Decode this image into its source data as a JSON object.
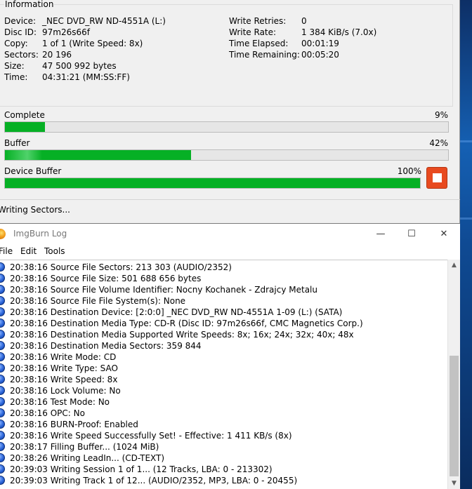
{
  "info": {
    "legend": "Information",
    "left": [
      {
        "label": "Device:",
        "value": "_NEC DVD_RW ND-4551A (L:)"
      },
      {
        "label": "Disc ID:",
        "value": "97m26s66f"
      },
      {
        "label": "Copy:",
        "value": "1 of 1 (Write Speed: 8x)"
      },
      {
        "label": "Sectors:",
        "value": "20 196"
      },
      {
        "label": "Size:",
        "value": "47 500 992 bytes"
      },
      {
        "label": "Time:",
        "value": "04:31:21 (MM:SS:FF)"
      }
    ],
    "right": [
      {
        "label": "Write Retries:",
        "value": "0"
      },
      {
        "label": "Write Rate:",
        "value": "1 384 KiB/s (7.0x)"
      },
      {
        "label": "Time Elapsed:",
        "value": "00:01:19"
      },
      {
        "label": "Time Remaining:",
        "value": "00:05:20"
      }
    ]
  },
  "progress": {
    "complete": {
      "label": "Complete",
      "pct_text": "9%",
      "fraction": 0.09
    },
    "buffer": {
      "label": "Buffer",
      "pct_text": "42%",
      "fraction": 0.42
    },
    "device_buffer": {
      "label": "Device Buffer",
      "pct_text": "100%",
      "fraction": 1.0
    }
  },
  "status": {
    "text": "Writing Sectors..."
  },
  "log": {
    "title": "ImgBurn Log",
    "controls": {
      "minimize": "—",
      "maximize": "☐",
      "close": "✕"
    },
    "menu": [
      "File",
      "Edit",
      "Tools"
    ],
    "lines": [
      "20:38:16 Source File Sectors: 213 303 (AUDIO/2352)",
      "20:38:16 Source File Size: 501 688 656 bytes",
      "20:38:16 Source File Volume Identifier: Nocny Kochanek - Zdrajcy Metalu",
      "20:38:16 Source File File System(s): None",
      "20:38:16 Destination Device: [2:0:0] _NEC DVD_RW ND-4551A 1-09 (L:) (SATA)",
      "20:38:16 Destination Media Type: CD-R (Disc ID: 97m26s66f, CMC Magnetics Corp.)",
      "20:38:16 Destination Media Supported Write Speeds: 8x; 16x; 24x; 32x; 40x; 48x",
      "20:38:16 Destination Media Sectors: 359 844",
      "20:38:16 Write Mode: CD",
      "20:38:16 Write Type: SAO",
      "20:38:16 Write Speed: 8x",
      "20:38:16 Lock Volume: No",
      "20:38:16 Test Mode: No",
      "20:38:16 OPC: No",
      "20:38:16 BURN-Proof: Enabled",
      "20:38:16 Write Speed Successfully Set! - Effective: 1 411 KB/s (8x)",
      "20:38:17 Filling Buffer... (1024 MiB)",
      "20:38:26 Writing LeadIn... (CD-TEXT)",
      "20:39:03 Writing Session 1 of 1... (12 Tracks, LBA: 0 - 213302)",
      "20:39:03 Writing Track 1 of 12... (AUDIO/2352, MP3, LBA: 0 - 20455)"
    ]
  },
  "colors": {
    "progress": "#06b025",
    "stop": "#e84a1f"
  },
  "icons": {
    "stop": "stop-icon",
    "log_line": "info-icon",
    "app": "imgburn-icon"
  }
}
